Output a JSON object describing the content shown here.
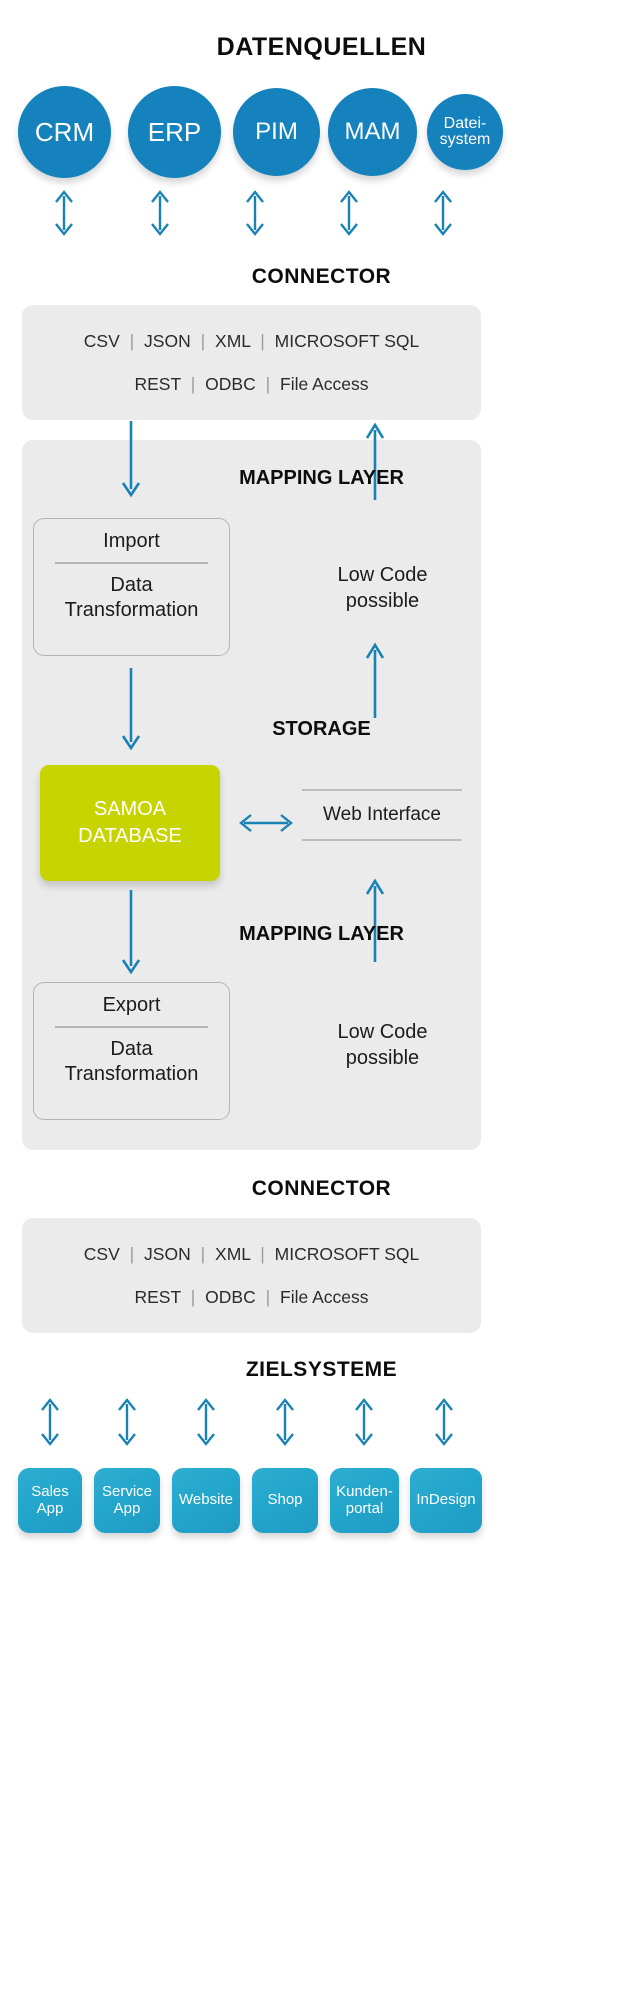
{
  "headings": {
    "data_sources": "DATENQUELLEN",
    "connector_top": "CONNECTOR",
    "connector_bottom": "CONNECTOR",
    "target_systems": "ZIELSYSTEME",
    "mapping_layer_top": "MAPPING LAYER",
    "mapping_layer_bottom": "MAPPING LAYER",
    "storage": "STORAGE"
  },
  "data_sources": [
    {
      "label": "CRM"
    },
    {
      "label": "ERP"
    },
    {
      "label": "PIM"
    },
    {
      "label": "MAM"
    },
    {
      "label": "Datei-\nsystem"
    }
  ],
  "connector_top": {
    "row1": [
      "CSV",
      "JSON",
      "XML",
      "MICROSOFT SQL"
    ],
    "row2": [
      "REST",
      "ODBC",
      "File Access"
    ],
    "separator": "|"
  },
  "connector_bottom": {
    "row1": [
      "CSV",
      "JSON",
      "XML",
      "MICROSOFT SQL"
    ],
    "row2": [
      "REST",
      "ODBC",
      "File Access"
    ],
    "separator": "|"
  },
  "import_card": {
    "title": "Import",
    "subtitle": "Data\nTransformation"
  },
  "export_card": {
    "title": "Export",
    "subtitle": "Data\nTransformation"
  },
  "low_code_top": "Low Code\npossible",
  "low_code_bottom": "Low Code\npossible",
  "storage": {
    "database_label": "SAMOA\nDATABASE",
    "web_interface_label": "Web Interface"
  },
  "target_systems": [
    {
      "label": "Sales\nApp"
    },
    {
      "label": "Service\nApp"
    },
    {
      "label": "Website"
    },
    {
      "label": "Shop"
    },
    {
      "label": "Kunden-\nportal"
    },
    {
      "label": "InDesign"
    }
  ],
  "colors": {
    "source_circle": "#1581bd",
    "target_box": "#23a6cc",
    "database": "#c8d400",
    "arrow": "#1881b5",
    "panel": "#ebebeb",
    "heading": "#0d0d0d"
  }
}
